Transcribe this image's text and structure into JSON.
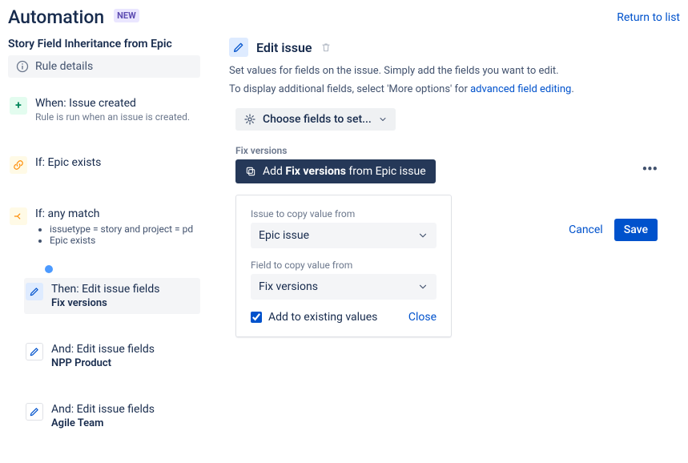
{
  "header": {
    "title": "Automation",
    "badge": "NEW",
    "return_link": "Return to list"
  },
  "rule": {
    "name": "Story Field Inheritance from Epic",
    "details_label": "Rule details"
  },
  "tree": {
    "when": {
      "title": "When: Issue created",
      "sub": "Rule is run when an issue is created."
    },
    "if1": {
      "title": "If: Epic exists"
    },
    "if2": {
      "title": "If: any match",
      "bullets": [
        "issuetype = story and project = pd",
        "Epic exists"
      ]
    },
    "then1": {
      "title": "Then: Edit issue fields",
      "sub": "Fix versions"
    },
    "and1": {
      "title": "And: Edit issue fields",
      "sub": "NPP Product"
    },
    "and2": {
      "title": "And: Edit issue fields",
      "sub": "Agile Team"
    }
  },
  "detail": {
    "title": "Edit issue",
    "desc1": "Set values for fields on the issue. Simply add the fields you want to edit.",
    "desc2_prefix": "To display additional fields, select 'More options' for ",
    "desc2_link": "advanced field editing",
    "choose_fields": "Choose fields to set...",
    "fix_versions_label": "Fix versions",
    "pill_prefix": "Add ",
    "pill_strong": "Fix versions",
    "pill_suffix": " from Epic issue"
  },
  "card": {
    "issue_copy_label": "Issue to copy value from",
    "issue_copy_value": "Epic issue",
    "field_copy_label": "Field to copy value from",
    "field_copy_value": "Fix versions",
    "add_existing": "Add to existing values",
    "close": "Close"
  },
  "actions": {
    "cancel": "Cancel",
    "save": "Save"
  }
}
